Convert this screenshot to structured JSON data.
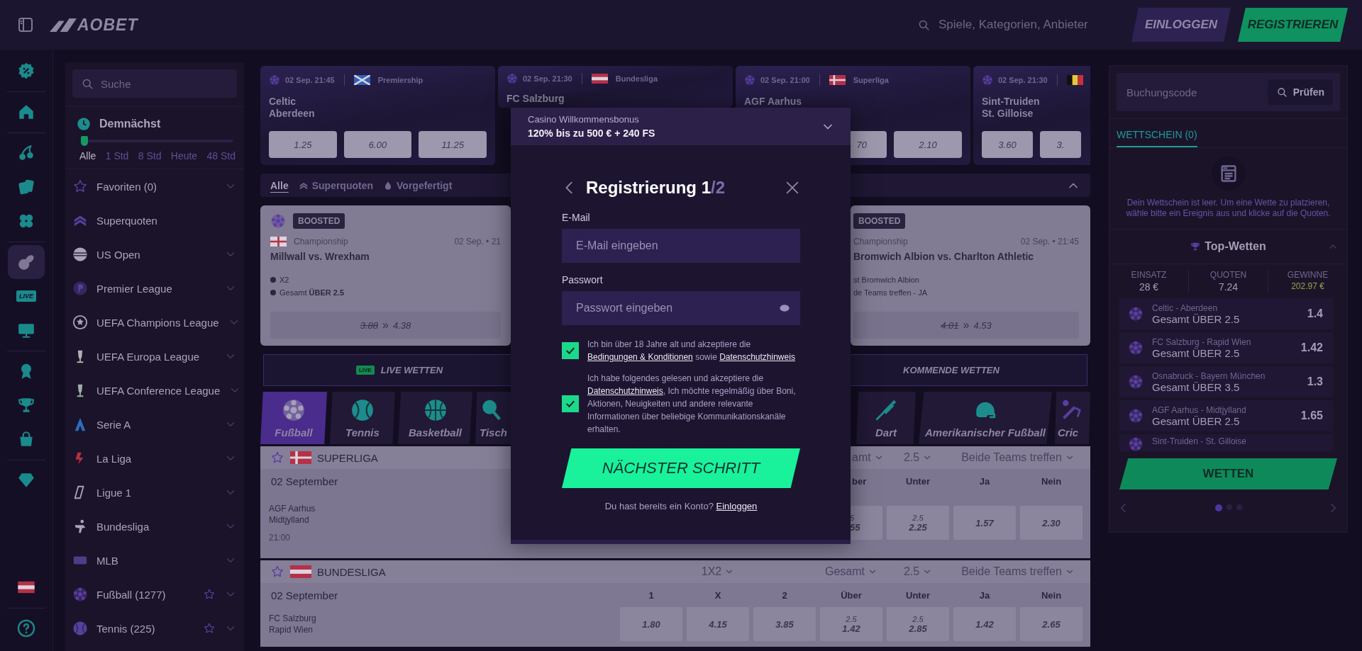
{
  "header": {
    "logo": "AOBET",
    "search": {
      "placeholder": "Spiele, Kategorien, Anbieter"
    },
    "buttons": [
      {
        "label": "EINLOGGEN",
        "kind": "login"
      },
      {
        "label": "REGISTRIEREN",
        "kind": "register"
      }
    ]
  },
  "rail": {
    "groups": [
      {
        "items": [
          {
            "kind": "percent",
            "selected": false
          }
        ]
      },
      {
        "items": [
          {
            "kind": "home",
            "selected": false
          }
        ]
      },
      {
        "items": [
          {
            "kind": "cherries",
            "selected": false
          },
          {
            "kind": "cards",
            "selected": false
          },
          {
            "kind": "clover",
            "selected": false
          }
        ]
      },
      {
        "items": [
          {
            "kind": "sports",
            "selected": true
          },
          {
            "kind": "live",
            "label": "LIVE",
            "selected": false
          },
          {
            "kind": "monitor",
            "selected": false
          }
        ]
      },
      {
        "items": [
          {
            "kind": "award",
            "selected": false
          },
          {
            "kind": "trophy",
            "selected": false
          },
          {
            "kind": "bag",
            "selected": false
          }
        ]
      },
      {
        "items": [
          {
            "kind": "diamond",
            "selected": false
          }
        ]
      }
    ],
    "bottom": [
      {
        "kind": "flag",
        "selected": false
      },
      {
        "kind": "help",
        "selected": false
      }
    ]
  },
  "sidebar": {
    "search": {
      "placeholder": "Suche"
    },
    "upcoming": {
      "title": "Demnächst",
      "level": 0,
      "options": [
        {
          "label": "Alle",
          "selected": true
        },
        {
          "label": "1 Std",
          "selected": false
        },
        {
          "label": "8 Std",
          "selected": false
        },
        {
          "label": "Heute",
          "selected": false
        },
        {
          "label": "48 Std",
          "selected": false
        }
      ]
    },
    "items": [
      {
        "label": "Favoriten (0)",
        "kind": "star",
        "expandable": true,
        "favorite": false
      },
      {
        "label": "Superquoten",
        "kind": "chevrons",
        "expandable": false,
        "favorite": false
      },
      {
        "label": "US Open",
        "kind": "uso",
        "expandable": true,
        "favorite": false
      },
      {
        "label": "Premier League",
        "kind": "premier",
        "expandable": true,
        "favorite": false
      },
      {
        "label": "UEFA Champions League",
        "kind": "ucl",
        "expandable": true,
        "favorite": false
      },
      {
        "label": "UEFA Europa League",
        "kind": "uel",
        "expandable": true,
        "favorite": false
      },
      {
        "label": "UEFA Conference League",
        "kind": "uecl",
        "expandable": true,
        "favorite": false
      },
      {
        "label": "Serie A",
        "kind": "seriea",
        "expandable": true,
        "favorite": false
      },
      {
        "label": "La Liga",
        "kind": "laliga",
        "expandable": true,
        "favorite": false
      },
      {
        "label": "Ligue 1",
        "kind": "ligue1",
        "expandable": true,
        "favorite": false
      },
      {
        "label": "Bundesliga",
        "kind": "bundesliga",
        "expandable": true,
        "favorite": false
      },
      {
        "label": "MLB",
        "kind": "mlb",
        "expandable": true,
        "favorite": false
      },
      {
        "label": "Fußball (1277)",
        "kind": "ball",
        "expandable": true,
        "favorite": true
      },
      {
        "label": "Tennis (225)",
        "kind": "tennisball",
        "expandable": true,
        "favorite": true
      }
    ]
  },
  "featured": [
    {
      "time": "02 Sep. 21:45",
      "league": "Premiership",
      "teams": [
        "Celtic",
        "Aberdeen"
      ],
      "odds": [
        "1.25",
        "6.00",
        "11.25"
      ]
    },
    {
      "time": "02 Sep. 21:30",
      "league": "Bundesliga",
      "teams": [
        "FC Salzburg"
      ]
    },
    {
      "time": "02 Sep. 21:00",
      "league": "Superliga",
      "teams": [
        "AGF Aarhus"
      ],
      "odds": [
        "70",
        "2.10"
      ]
    },
    {
      "time": "02 Sep. 21:30",
      "teams": [
        "Sint-Truiden",
        "St. Gilloise"
      ],
      "odds": [
        "3.60",
        "3."
      ]
    }
  ],
  "filters": [
    {
      "label": "Alle",
      "kind": "all",
      "selected": true
    },
    {
      "label": "Superquoten",
      "kind": "boosted",
      "selected": false
    },
    {
      "label": "Vorgefertigt",
      "kind": "prebuilt",
      "selected": false
    }
  ],
  "boosted": [
    {
      "badge": "BOOSTED",
      "league": "Championship",
      "time": "02 Sep. • 21",
      "title": "Millwall vs. Wrexham",
      "picks": [
        "X2",
        "Gesamt **ÜBER 2.5**"
      ],
      "old_odd": "3.88",
      "arrow": "»",
      "new_odd": "4.38"
    },
    {
      "badge": "BOOSTED",
      "league": "Championship",
      "time": "02 Sep. • 21:45",
      "title": "Bromwich Albion vs. Charlton Athletic",
      "picks": [
        "st Bromwich Albion",
        "de Teams treffen - JA"
      ],
      "old_odd": "4.01",
      "arrow": "»",
      "new_odd": "4.53"
    }
  ],
  "modes": [
    {
      "badge": "LIVE",
      "label": "LIVE WETTEN"
    },
    {
      "label": "KOMMENDE WETTEN"
    }
  ],
  "sports": [
    {
      "label": "Fußball",
      "kind": "ball",
      "selected": true
    },
    {
      "label": "Tennis",
      "kind": "tennisball",
      "selected": false
    },
    {
      "label": "Basketball",
      "kind": "basketball",
      "selected": false
    },
    {
      "label": "Tisch",
      "kind": "pingpong",
      "selected": false
    },
    {
      "label": "Dart",
      "kind": "dart",
      "selected": false
    },
    {
      "label": "Amerikanischer Fußball",
      "kind": "helmet",
      "selected": false
    },
    {
      "label": "Cric",
      "kind": "cricket",
      "selected": false
    }
  ],
  "leagues": [
    {
      "name": "SUPERLIGA",
      "markets": [
        "amt",
        "2.5",
        "Beide Teams treffen"
      ],
      "date": "02 September",
      "columns": [
        "ber",
        "Unter",
        "Ja",
        "Nein"
      ],
      "matches": [
        {
          "teams": [
            "AGF Aarhus",
            "Midtjylland"
          ],
          "time": "21:00",
          "odds": [
            {
              "line": "5",
              "odd": "55"
            },
            {
              "line": "2.5",
              "odd": "2.25"
            },
            {
              "odd": "1.57"
            },
            {
              "odd": "2.30"
            }
          ]
        }
      ]
    },
    {
      "name": "BUNDESLIGA",
      "markets": [
        "1X2",
        "Gesamt",
        "2.5",
        "Beide Teams treffen"
      ],
      "date": "02 September",
      "columns": [
        "1",
        "X",
        "2",
        "Über",
        "Unter",
        "Ja",
        "Nein"
      ],
      "matches": [
        {
          "teams": [
            "FC Salzburg",
            "Rapid Wien"
          ],
          "odds": [
            {
              "odd": "1.80"
            },
            {
              "odd": "4.15"
            },
            {
              "odd": "3.85"
            },
            {
              "line": "2.5",
              "odd": "1.42"
            },
            {
              "line": "2.5",
              "odd": "2.85"
            },
            {
              "odd": "1.42"
            },
            {
              "odd": "2.65"
            }
          ]
        }
      ]
    }
  ],
  "betslip": {
    "booking": {
      "placeholder": "Buchungscode",
      "button": "Prüfen"
    },
    "tabs": [
      {
        "label": "WETTSCHEIN (0)",
        "selected": true
      }
    ],
    "empty": "Dein Wettschein ist leer. Um eine Wette zu platzieren, wähle bitte ein Ereignis aus und klicke auf die Quoten.",
    "top": {
      "title": "Top-Wetten",
      "stats": [
        {
          "label": "EINSATZ",
          "value": "28 €",
          "kind": "plain"
        },
        {
          "label": "QUOTEN",
          "value": "7.24",
          "kind": "plain"
        },
        {
          "label": "GEWINNE",
          "value": "202.97 €",
          "kind": "win"
        }
      ],
      "bets": [
        {
          "match": "Celtic - Aberdeen",
          "market": "Gesamt ÜBER 2.5",
          "odd": "1.4"
        },
        {
          "match": "FC Salzburg - Rapid Wien",
          "market": "Gesamt ÜBER 2.5",
          "odd": "1.42"
        },
        {
          "match": "Osnabruck - Bayern München",
          "market": "Gesamt ÜBER 3.5",
          "odd": "1.3"
        },
        {
          "match": "AGF Aarhus - Midtjylland",
          "market": "Gesamt ÜBER 2.5",
          "odd": "1.65"
        },
        {
          "match": "Sint-Truiden - St. Gilloise"
        }
      ],
      "button": "WETTEN",
      "pages": [
        {
          "selected": true
        },
        {
          "selected": false
        },
        {
          "selected": false
        }
      ]
    }
  },
  "modal": {
    "bonus": {
      "title": "Casino Willkommensbonus",
      "offer": "120% bis zu 500 € + 240 FS"
    },
    "title": "Registrierung 1",
    "step_total": "/2",
    "fields": [
      {
        "label": "E-Mail",
        "placeholder": "E-Mail eingeben",
        "kind": "email"
      },
      {
        "label": "Passwort",
        "placeholder": "Passwort eingeben",
        "kind": "password"
      }
    ],
    "consents": [
      {
        "checked": true,
        "parts": [
          {
            "text": "Ich bin über 18 Jahre alt und akzeptiere die "
          },
          {
            "link": "Bedingungen & Konditionen"
          },
          {
            "text": " sowie "
          },
          {
            "link": "Datenschutzhinweis"
          }
        ]
      },
      {
        "checked": true,
        "parts": [
          {
            "text": "Ich habe folgendes gelesen und akzeptiere die "
          },
          {
            "link": "Datenschutzhinweis"
          },
          {
            "text": ", Ich möchte regelmäßig über Boni, Aktionen, Neuigkeiten und andere relevante Informationen über beliebige Kommunikationskanäle erhalten."
          }
        ]
      }
    ],
    "submit": "NÄCHSTER SCHRITT",
    "footer": "Du hast bereits ein Konto?",
    "footer_link": "Einloggen"
  }
}
